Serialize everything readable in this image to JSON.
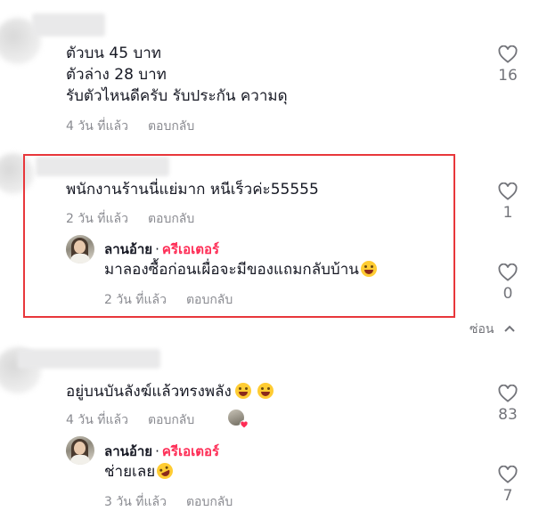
{
  "comments": [
    {
      "text_lines": [
        "ตัวบน 45 บาท",
        "ตัวล่าง 28 บาท",
        "รับตัวไหนดีครับ รับประกัน ความดุ"
      ],
      "time": "4 วัน ที่แล้ว",
      "reply_label": "ตอบกลับ",
      "likes": "16"
    },
    {
      "text": "พนักงานร้านนี่แย่มาก หนีเร็วค่ะ55555",
      "time": "2 วัน ที่แล้ว",
      "reply_label": "ตอบกลับ",
      "likes": "1",
      "reply": {
        "author": "ลานอ้าย",
        "separator": "·",
        "badge": "ครีเอเตอร์",
        "text": "มาลองซื้อก่อนเผื่อจะมีของแถมกลับบ้าน",
        "emoji": "sweat-smile-emoji",
        "time": "2 วัน ที่แล้ว",
        "reply_label": "ตอบกลับ",
        "likes": "0"
      }
    },
    {
      "text": "อยู่บนบันลังฆ์แล้วทรงพลัง",
      "emoji": "joy-emoji",
      "time": "4 วัน ที่แล้ว",
      "reply_label": "ตอบกลับ",
      "likes": "83",
      "reply": {
        "author": "ลานอ้าย",
        "separator": "·",
        "badge": "ครีเอเตอร์",
        "text": "ช่ายเลย",
        "emoji": "rofl-emoji",
        "time": "3 วัน ที่แล้ว",
        "reply_label": "ตอบกลับ",
        "likes": "7"
      }
    }
  ],
  "hide_label": "ซ่อน",
  "colors": {
    "creator_badge": "#fe2c55",
    "highlight_border": "#e8373b",
    "meta_text": "#8a8b91"
  }
}
